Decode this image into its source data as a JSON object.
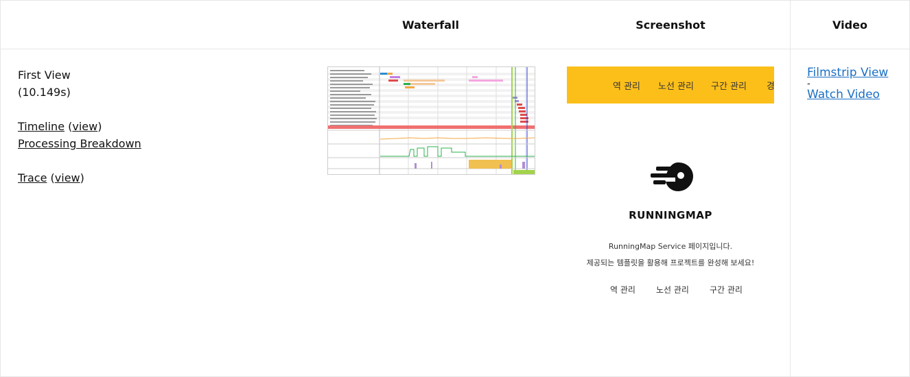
{
  "header": {
    "col_waterfall": "Waterfall",
    "col_screenshot": "Screenshot",
    "col_video": "Video"
  },
  "run": {
    "label": "First View",
    "time": "(10.149s)",
    "timeline_link": "Timeline",
    "timeline_view_link": "view",
    "processing_link": "Processing Breakdown",
    "trace_link": "Trace",
    "trace_view_link": "view"
  },
  "screenshot": {
    "nav_items": [
      "역 관리",
      "노선 관리",
      "구간 관리",
      "경"
    ],
    "logo_text": "RUNNINGMAP",
    "desc_line1": "RunningMap Service 페이지입니다.",
    "desc_line2": "제공되는 템플릿을 활용해 프로젝트를 완성해 보세요!",
    "links": [
      "역 관리",
      "노선 관리",
      "구간 관리"
    ],
    "nav_color": "#fcbf1a"
  },
  "video": {
    "filmstrip_link": "Filmstrip View",
    "separator": "-",
    "watch_link": "Watch Video",
    "link_color": "#1a6fc4"
  }
}
